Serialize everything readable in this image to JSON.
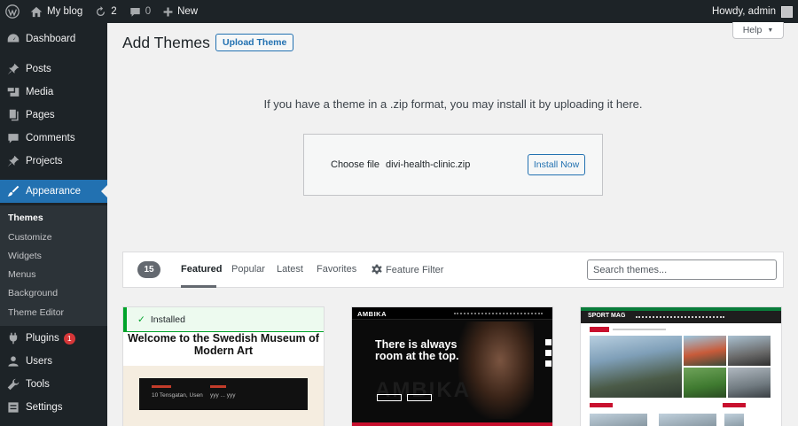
{
  "adminbar": {
    "site_name": "My blog",
    "updates_count": "2",
    "comments_count": "0",
    "new_label": "New",
    "greeting": "Howdy, admin"
  },
  "sidebar": {
    "items": [
      {
        "label": "Dashboard",
        "icon": "dashboard-icon"
      },
      {
        "label": "Posts",
        "icon": "pin-icon"
      },
      {
        "label": "Media",
        "icon": "media-icon"
      },
      {
        "label": "Pages",
        "icon": "pages-icon"
      },
      {
        "label": "Comments",
        "icon": "comment-icon"
      },
      {
        "label": "Projects",
        "icon": "pin-icon"
      },
      {
        "label": "Appearance",
        "icon": "paintbrush-icon"
      },
      {
        "label": "Plugins",
        "icon": "plugin-icon",
        "badge": "1"
      },
      {
        "label": "Users",
        "icon": "users-icon"
      },
      {
        "label": "Tools",
        "icon": "wrench-icon"
      },
      {
        "label": "Settings",
        "icon": "settings-icon"
      }
    ],
    "submenu": [
      "Themes",
      "Customize",
      "Widgets",
      "Menus",
      "Background",
      "Theme Editor"
    ]
  },
  "header": {
    "title": "Add Themes",
    "upload_button": "Upload Theme",
    "help_label": "Help"
  },
  "upload": {
    "instructions": "If you have a theme in a .zip format, you may install it by uploading it here.",
    "choose_file_label": "Choose file",
    "file_name": "divi-health-clinic.zip",
    "install_button": "Install Now"
  },
  "filter": {
    "count": "15",
    "tabs": [
      "Featured",
      "Popular",
      "Latest",
      "Favorites"
    ],
    "feature_filter": "Feature Filter",
    "search_placeholder": "Search themes..."
  },
  "themes": {
    "card1": {
      "installed_label": "Installed",
      "preview_title": "Welcome to the Swedish Museum of Modern Art",
      "strip_text_1": "10 Tensgatan, Usen",
      "strip_text_2": "ууу ... ууу"
    },
    "card2": {
      "logo": "AMBIKA",
      "headline": "There is always room at the top.",
      "watermark": "AMBIKA"
    },
    "card3": {
      "logo": "SPORT MAG"
    }
  },
  "colors": {
    "admin_bg": "#1d2327",
    "accent": "#2271b1",
    "installed_green": "#00a32a",
    "badge_red": "#d63638"
  }
}
